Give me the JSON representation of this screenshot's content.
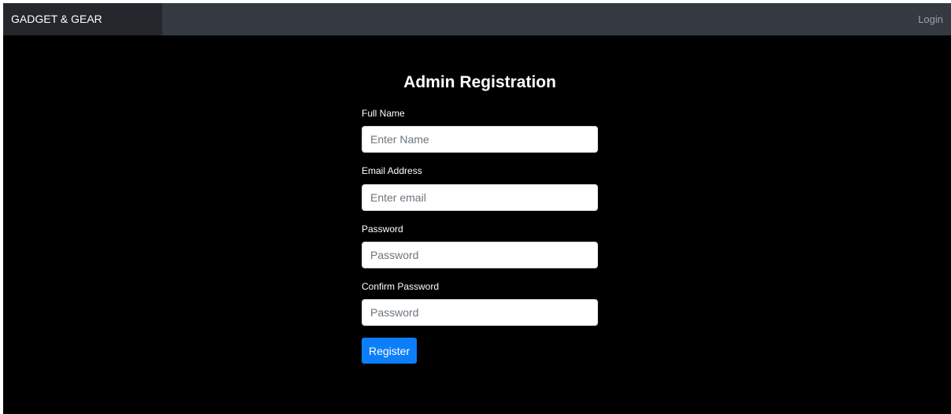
{
  "navbar": {
    "brand": "GADGET & GEAR",
    "login": "Login"
  },
  "form": {
    "title": "Admin Registration",
    "fields": [
      {
        "label": "Full Name",
        "placeholder": "Enter Name"
      },
      {
        "label": "Email Address",
        "placeholder": "Enter email"
      },
      {
        "label": "Password",
        "placeholder": "Password"
      },
      {
        "label": "Confirm Password",
        "placeholder": "Password"
      }
    ],
    "submit_label": "Register"
  },
  "colors": {
    "navbar_bg": "#343a40",
    "brand_bg": "#24282c",
    "page_bg": "#000000",
    "accent": "#0d7efa"
  }
}
